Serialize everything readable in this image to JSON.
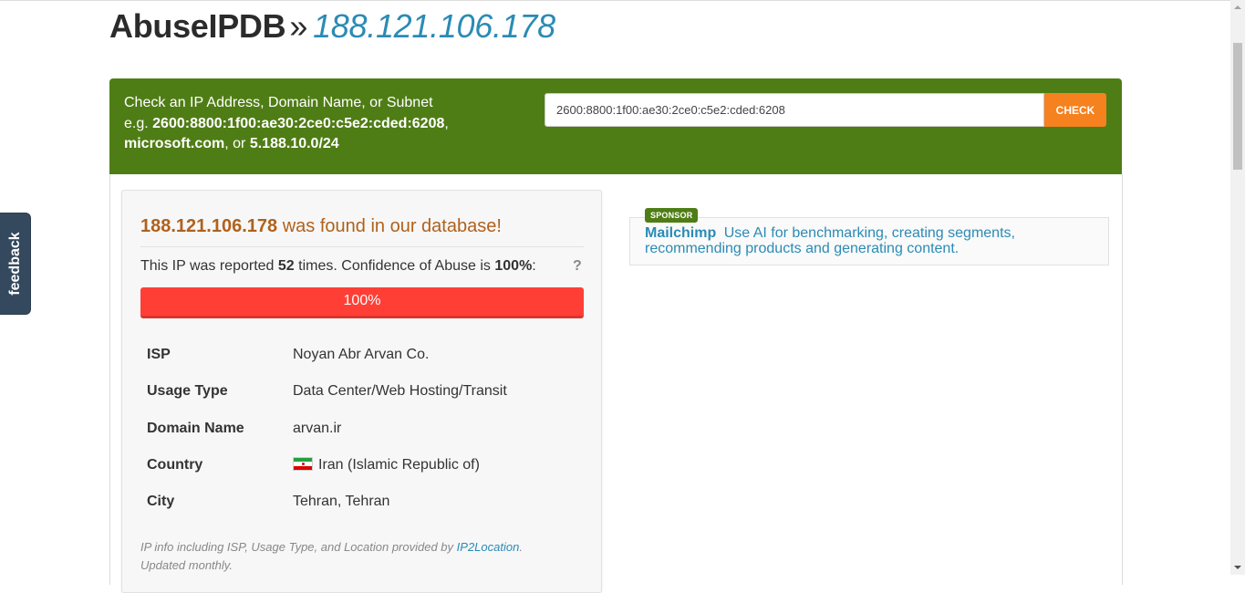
{
  "header": {
    "site_name": "AbuseIPDB",
    "separator": "»",
    "ip": "188.121.106.178"
  },
  "search": {
    "intro": "Check an IP Address, Domain Name, or Subnet",
    "example_prefix": "e.g.",
    "example_ip": "2600:8800:1f00:ae30:2ce0:c5e2:cded:6208",
    "example_comma": ",",
    "example_domain": "microsoft.com",
    "example_or": ", or",
    "example_subnet": "5.188.10.0/24",
    "input_value": "2600:8800:1f00:ae30:2ce0:c5e2:cded:6208",
    "check_label": "CHECK"
  },
  "result": {
    "ip": "188.121.106.178",
    "found_text": "was found in our database!",
    "reported_prefix": "This IP was reported",
    "report_count": "52",
    "reported_mid": "times. Confidence of Abuse is",
    "confidence": "100%",
    "colon": ":",
    "help_mark": "?",
    "confidence_fraction": 1.0,
    "bar_label": "100%",
    "bar_color": "#ff3f36",
    "info": [
      {
        "label": "ISP",
        "value": "Noyan Abr Arvan Co."
      },
      {
        "label": "Usage Type",
        "value": "Data Center/Web Hosting/Transit"
      },
      {
        "label": "Domain Name",
        "value": "arvan.ir"
      },
      {
        "label": "Country",
        "value": "Iran (Islamic Republic of)",
        "flag_icon": "iran-flag-icon"
      },
      {
        "label": "City",
        "value": "Tehran, Tehran"
      }
    ],
    "footnote_prefix": "IP info including ISP, Usage Type, and Location provided by",
    "footnote_link": "IP2Location",
    "footnote_suffix": ". Updated monthly."
  },
  "sponsor": {
    "badge": "SPONSOR",
    "name": "Mailchimp",
    "text": "Use AI for benchmarking, creating segments, recommending products and generating content."
  },
  "feedback": {
    "label": "feedback"
  },
  "colors": {
    "brand_green": "#4f7d15",
    "accent_orange": "#f5821f",
    "link_blue": "#2a8bb5",
    "found_orange": "#b0611c",
    "danger_red": "#ff3f36"
  }
}
